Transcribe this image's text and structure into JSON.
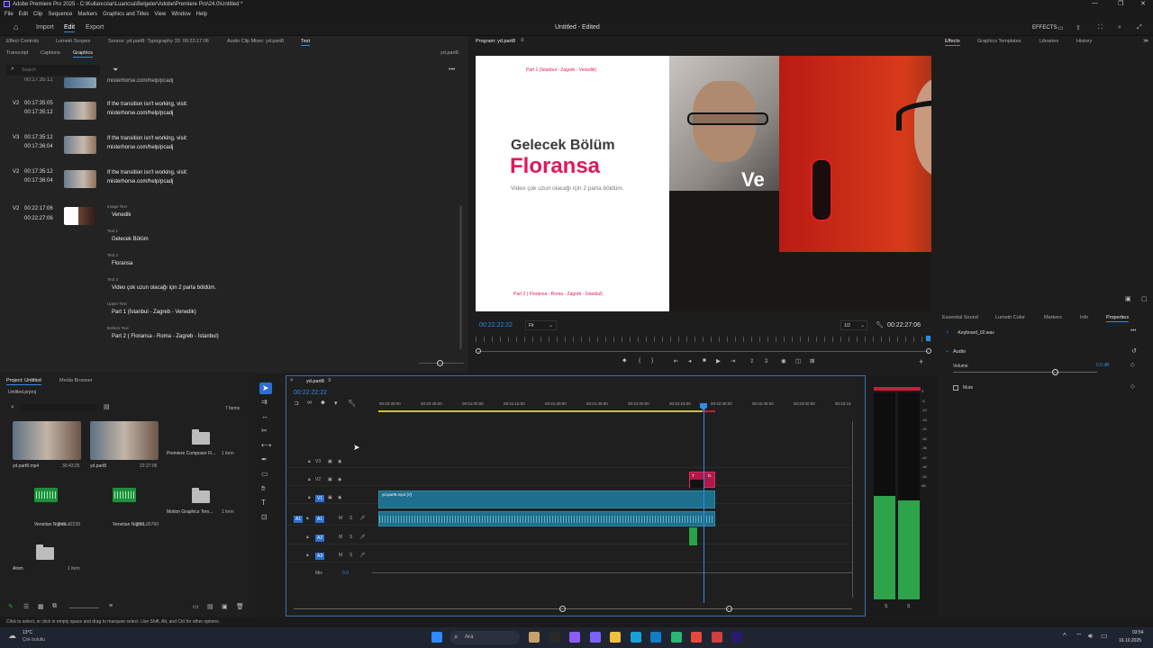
{
  "window": {
    "title": "Adobe Premiere Pro 2025 - C:\\Kullanıcılar\\Luaricsa\\Belgeler\\Adobe\\Premiere Pro\\24.0\\Untitled *"
  },
  "menu": [
    "File",
    "Edit",
    "Clip",
    "Sequence",
    "Markers",
    "Graphics and Titles",
    "View",
    "Window",
    "Help"
  ],
  "workspace": {
    "import": "Import",
    "edit": "Edit",
    "export": "Export",
    "project_title": "Untitled - Edited",
    "effects_label": "EFFECTS"
  },
  "source_panel": {
    "tabs": [
      "Effect Controls",
      "Lumetri Scopes",
      "Source: yd.part8: Typography 33: 00:22:17:06",
      "Audio Clip Mixer: yd.part8",
      "Text"
    ],
    "subtabs": [
      "Transcript",
      "Captions",
      "Graphics"
    ],
    "seq_label": "yd.part8",
    "search_placeholder": "Search",
    "clips": [
      {
        "track": "V2",
        "in": "00:17:35:05",
        "out": "00:17:35:12",
        "line1": "If the transition isn't working, visit:",
        "line2": "misterhorse.com/help/pcadj"
      },
      {
        "track": "V3",
        "in": "00:17:35:12",
        "out": "00:17:36:04",
        "line1": "If the transition isn't working, visit:",
        "line2": "misterhorse.com/help/pcadj"
      },
      {
        "track": "V2",
        "in": "00:17:35:12",
        "out": "00:17:36:04",
        "line1": "If the transition isn't working, visit:",
        "line2": "misterhorse.com/help/pcadj"
      }
    ],
    "top_partial": {
      "time": "00:17:35:12",
      "text": "misterhorse.com/help/pcadj"
    },
    "graphic": {
      "track": "V2",
      "in": "00:22:17:06",
      "out": "00:22:27:06",
      "fields": [
        {
          "label": "Image Text",
          "value": "Venedik"
        },
        {
          "label": "Text 1",
          "value": "Gelecek Bölüm"
        },
        {
          "label": "Text 2",
          "value": "Floransa"
        },
        {
          "label": "Text 3",
          "value": "Video çok uzun olacağı için 2 parta böldüm."
        },
        {
          "label": "Upper Text",
          "value": "Part 1 (İstanbul - Zagreb - Venedik)"
        },
        {
          "label": "Bottom Text",
          "value": "Part 2 ( Floransa - Roma - Zagreb - İstanbul)"
        }
      ]
    }
  },
  "program": {
    "title": "Program: yd.part8",
    "upper": "Part 1 (İstanbul - Zagreb - Venedik)",
    "heading": "Gelecek Bölüm",
    "city": "Floransa",
    "sub": "Video çok uzun olacağı için 2 parta böldüm.",
    "bottom": "Part 2 ( Floransa - Roma - Zagreb - İstanbul)",
    "overlay_text": "Ve",
    "timecode": "00:22:22:22",
    "fit": "Fit",
    "res": "1/2",
    "duration": "00:22:27:06"
  },
  "right_tabs": [
    "Effects",
    "Graphics Templates",
    "Libraries",
    "History"
  ],
  "right_lower": {
    "tabs": [
      "Essential Sound",
      "Lumetri Color",
      "Markers",
      "Info",
      "Properties"
    ],
    "clip": "-Keyboard_02.wav",
    "audio_label": "Audio",
    "volume_label": "Volume",
    "volume_value": "0.0 dB",
    "mute_label": "Mute"
  },
  "project": {
    "tabs": [
      "Project: Untitled",
      "Media Browser"
    ],
    "file": "Untitled.prproj",
    "count": "7 items",
    "items": [
      {
        "name": "yd.part8.mp4",
        "meta": "30:43:25"
      },
      {
        "name": "yd.part8",
        "meta": "22:27:06"
      },
      {
        "name": "Premiere Composer Fi...",
        "meta": "1 item"
      },
      {
        "name": "Venetian Nights...",
        "meta": "3:46:42239"
      },
      {
        "name": "Venetian Nights...",
        "meta": "3:21:05760"
      },
      {
        "name": "Motion Graphics Tem...",
        "meta": "1 item"
      },
      {
        "name": "Atom",
        "meta": "1 item"
      }
    ]
  },
  "timeline": {
    "seq": "yd.part8",
    "timecode": "00:22:22:22",
    "ruler": [
      "00:20:30:00",
      "00:20:45:00",
      "00:21:00:00",
      "00:21:15:00",
      "00:21:30:00",
      "00:21:45:00",
      "00:22:00:00",
      "00:22:15:00",
      "00:22:30:00",
      "00:22:45:00",
      "00:23:00:00",
      "00:23:15"
    ],
    "tracks_v": [
      "V3",
      "V2",
      "V1"
    ],
    "tracks_a": [
      "A1",
      "A2",
      "A3"
    ],
    "mix": "Mix",
    "mix_val": "0.0",
    "clip_v1": "yd.part8.mp4 [V]",
    "clip_t": "T",
    "clip_fx": "fx"
  },
  "meter_scale": [
    "0",
    "-6",
    "-12",
    "-18",
    "-24",
    "-30",
    "-36",
    "-42",
    "-48",
    "-54",
    "dB"
  ],
  "meter_ss": [
    "S",
    "S"
  ],
  "status": "Click to select, or click in empty space and drag to marquee select. Use Shift, Alt, and Ctrl for other options.",
  "taskbar": {
    "weather_temp": "13°C",
    "weather_desc": "Çok bulutlu",
    "search": "Ara",
    "time": "03:54",
    "date": "16.10.2025"
  },
  "colors": {
    "accent": "#2d8ceb",
    "pink": "#e0185c",
    "clipblue": "#1d6f8c"
  }
}
